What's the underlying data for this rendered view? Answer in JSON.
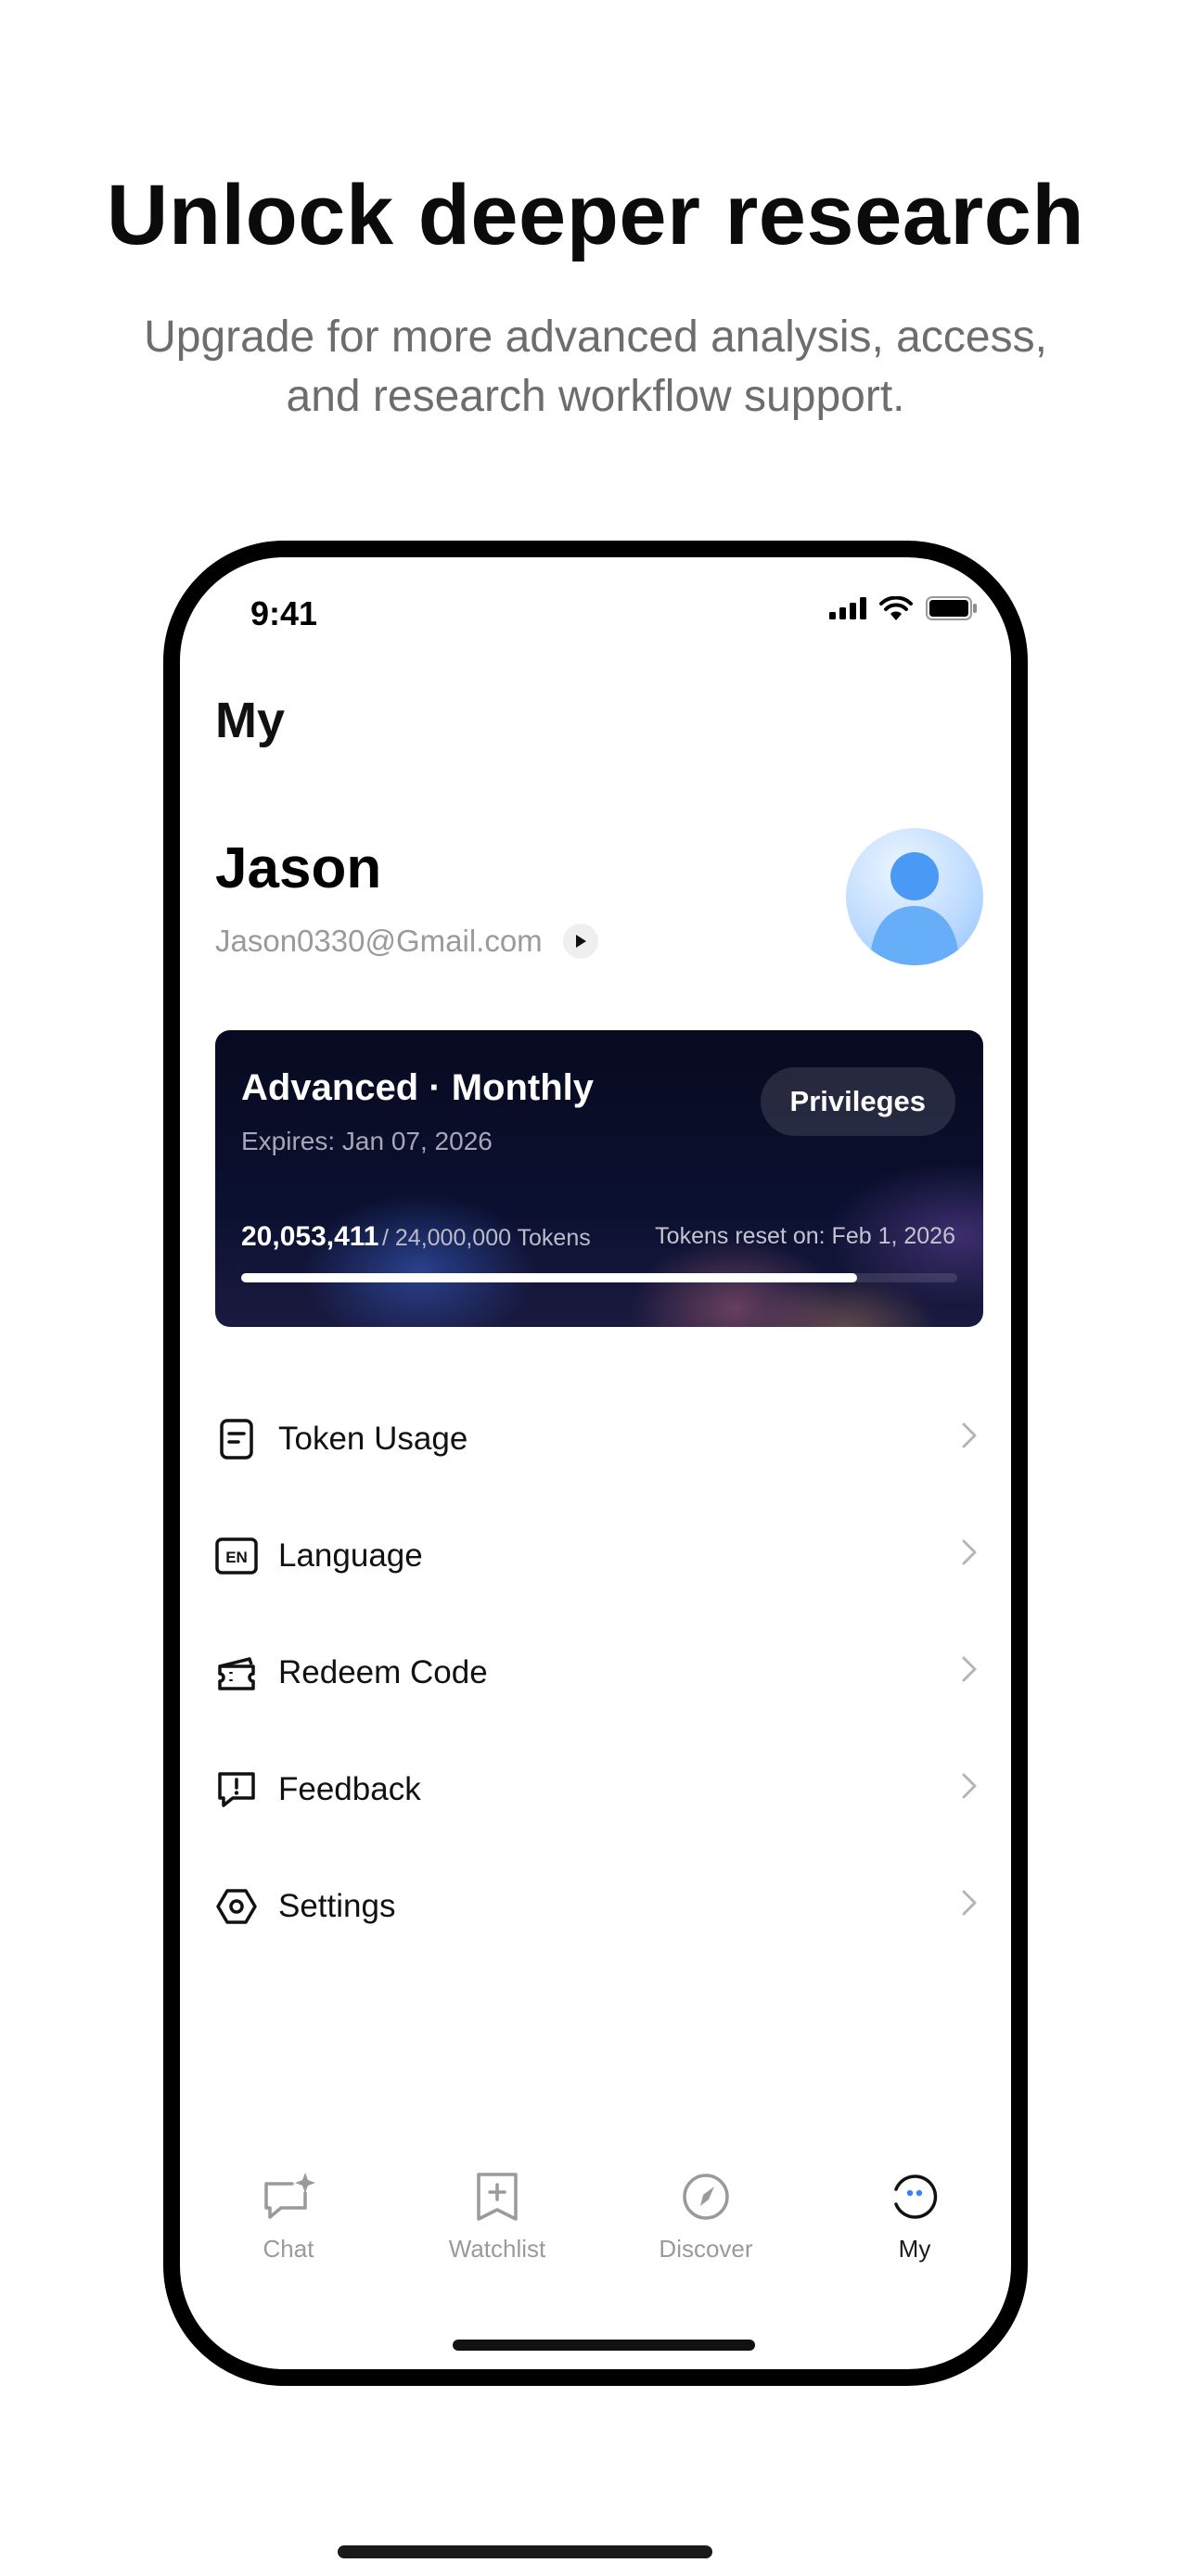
{
  "hero": {
    "title": "Unlock deeper research",
    "subtitle_line1": "Upgrade for more advanced analysis, access,",
    "subtitle_line2": "and research workflow support."
  },
  "status_bar": {
    "time": "9:41"
  },
  "page": {
    "title": "My"
  },
  "profile": {
    "name": "Jason",
    "email": "Jason0330@Gmail.com"
  },
  "plan": {
    "title": "Advanced · Monthly",
    "expires": "Expires: Jan 07, 2026",
    "privileges_label": "Privileges",
    "tokens_used": "20,053,411",
    "tokens_total": "/ 24,000,000 Tokens",
    "reset": "Tokens reset on: Feb 1, 2026",
    "usage_fraction": 0.86
  },
  "menu": {
    "items": [
      {
        "label": "Token Usage",
        "icon": "document-icon"
      },
      {
        "label": "Language",
        "icon": "en-icon",
        "icon_text": "EN"
      },
      {
        "label": "Redeem Code",
        "icon": "ticket-icon"
      },
      {
        "label": "Feedback",
        "icon": "feedback-icon"
      },
      {
        "label": "Settings",
        "icon": "settings-icon"
      }
    ]
  },
  "tabs": [
    {
      "label": "Chat",
      "icon": "chat-sparkle-icon",
      "active": false
    },
    {
      "label": "Watchlist",
      "icon": "bookmark-plus-icon",
      "active": false
    },
    {
      "label": "Discover",
      "icon": "compass-icon",
      "active": false
    },
    {
      "label": "My",
      "icon": "profile-icon",
      "active": true
    }
  ],
  "colors": {
    "accent": "#3b82f6",
    "inactive_tab": "#9a9a9a",
    "card_bg": "#0b1030"
  }
}
